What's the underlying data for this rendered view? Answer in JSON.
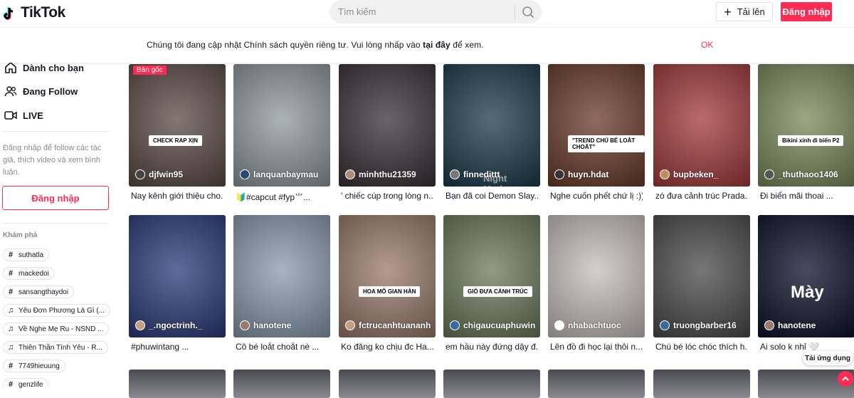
{
  "header": {
    "logo_text": "TikTok",
    "search_placeholder": "Tìm kiếm",
    "upload_label": "Tải lên",
    "login_label": "Đăng nhập"
  },
  "banner": {
    "text_before": "Chúng tôi đang cập nhật Chính sách quyền riêng tư. Vui lòng nhấp vào ",
    "link_text": "tại đây",
    "text_after": " để xem.",
    "ok_label": "OK"
  },
  "sidebar": {
    "nav": [
      {
        "label": "Dành cho bạn",
        "icon": "home-icon"
      },
      {
        "label": "Đang Follow",
        "icon": "following-icon"
      },
      {
        "label": "LIVE",
        "icon": "live-icon"
      }
    ],
    "hint": "Đăng nhập để follow các tác giả, thích video và xem bình luận.",
    "login_label": "Đăng nhập",
    "explore_title": "Khám phá",
    "tags": [
      {
        "label": "suthatla",
        "type": "hashtag"
      },
      {
        "label": "mackedoi",
        "type": "hashtag"
      },
      {
        "label": "sansangthaydoi",
        "type": "hashtag"
      },
      {
        "label": "Yêu Đơn Phương Là Gì (...",
        "type": "music"
      },
      {
        "label": "Về Nghe Mẹ Ru - NSND ...",
        "type": "music"
      },
      {
        "label": "Thiên Thần Tình Yêu - R...",
        "type": "music"
      },
      {
        "label": "7749hieuung",
        "type": "hashtag"
      },
      {
        "label": "genzlife",
        "type": "hashtag"
      }
    ]
  },
  "videos": [
    {
      "user": "djfwin95",
      "caption": "Nay kênh giới thiệu cho...",
      "badge": "Bản gốc",
      "overlay": "CHECK RAP XỊN",
      "bg": "#5a4a44",
      "avatar": "#444"
    },
    {
      "user": "lanquanbaymau",
      "caption": "🔰#capcut #fyp⺌...",
      "bg": "#8f9aa0",
      "avatar": "#2a4a7a"
    },
    {
      "user": "minhthu21359",
      "caption": "' chiếc cúp trong lòng n...",
      "bg": "#3a2f36",
      "avatar": "#b48a7a"
    },
    {
      "user": "finnedittt",
      "caption": "Bạn đã coi Demon Slay...",
      "overlay": "Night Motion",
      "bg": "#1c3a4a",
      "avatar": "#777"
    },
    {
      "user": "huyn.hdat",
      "caption": "Nghe cuốn phết chứ lị :)))",
      "overlay": "\"TREND CHÚ BÉ LOẮT CHOẮT\"",
      "bg": "#6a3a2a",
      "avatar": "#333"
    },
    {
      "user": "bupbeken_",
      "caption": "zó đưa cảnh trúc Prada...",
      "bg": "#a33a3a",
      "avatar": "#c48a5a"
    },
    {
      "user": "_thuthaoo1406",
      "caption": "Đi biển mãi thoai ...",
      "overlay": "Bikini xinh đi biển P2",
      "bg": "#7a8a5a",
      "avatar": "#555"
    },
    {
      "user": "_.ngoctrinh._",
      "caption": "#phuwintang ...",
      "bg": "#2a3a7a",
      "avatar": "#c4a080"
    },
    {
      "user": "hanotene",
      "caption": "Cô bé loắt choắt nè ...",
      "bg": "#8a9ab0",
      "avatar": "#9a7a6a"
    },
    {
      "user": "fctrucanhtuananh",
      "caption": "Ko đăng ko chịu đc Ha...",
      "overlay": "HOA MÔ GIAN HÀN",
      "bg": "#9a7a6a",
      "avatar": "#c4a080"
    },
    {
      "user": "chigaucuaphuwin",
      "caption": "em hầu này đứng dậy đ...",
      "overlay": "GIÓ ĐƯA CÀNH TRÚC",
      "bg": "#6a7a5a",
      "avatar": "#3a6aa0"
    },
    {
      "user": "nhabachtuoc",
      "caption": "Lên đồ đi học lại thôi n...",
      "bg": "#c8c0bc",
      "avatar": "#fff"
    },
    {
      "user": "truongbarber16",
      "caption": "Chú bé lóc chóc thích h...",
      "bg": "#4a4a4a",
      "avatar": "#3a6aa0"
    },
    {
      "user": "hanotene",
      "caption": "Ai solo k nhỉ 🤍",
      "overlay": "Mày",
      "bg": "#0a0f2a",
      "avatar": "#9a7a6a"
    }
  ],
  "floating": {
    "app_label": "Tải ứng dụng"
  }
}
